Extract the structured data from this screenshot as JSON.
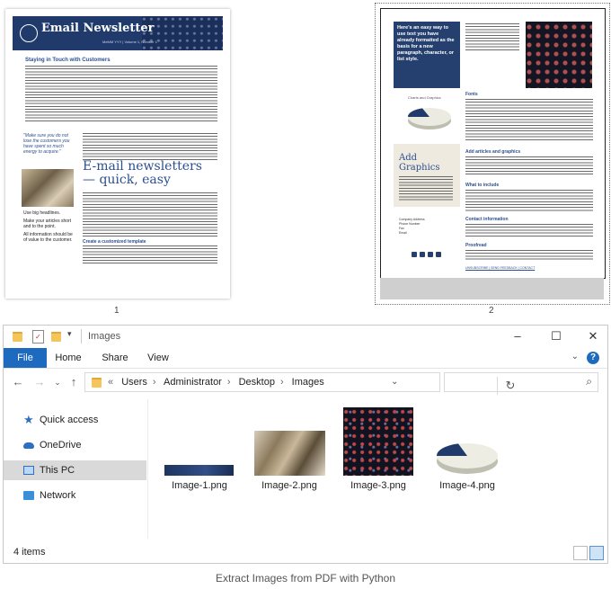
{
  "pdf_preview": {
    "page1": {
      "number": "1",
      "header_title": "Email Newsletter",
      "header_subtitle": "MeMM YYY | Volume 1, Number 1",
      "section_heading": "Staying in Touch with Customers",
      "pull_quote": "\"Make sure you do not lose the customers you have spent so much energy to acquire.\"",
      "big_heading": "E-mail newsletters — quick, easy",
      "list_items": [
        "Use big headlines.",
        "Make your articles short and to the point.",
        "All information should be of value to the customer."
      ],
      "sub_heading": "Create a customized template"
    },
    "page2": {
      "number": "2",
      "callout": "Here's an easy way to use text you have already formatted as the basis for a new paragraph, character, or list style.",
      "chart_title": "Charts and Graphics",
      "add_graphics": "Add Graphics",
      "headings": [
        "Fonts",
        "Add articles and graphics",
        "What to include",
        "Contact information",
        "Proofread"
      ],
      "contact_lines": [
        "Company Address",
        "Phone Number",
        "Fax",
        "Email"
      ],
      "footer_links": "UNSUBSCRIBE | SEND FEEDBACK | CONTACT"
    }
  },
  "explorer": {
    "title": "Images",
    "tabs": [
      "File",
      "Home",
      "Share",
      "View"
    ],
    "breadcrumb": [
      "Users",
      "Administrator",
      "Desktop",
      "Images"
    ],
    "breadcrumb_prefix": "«",
    "nav_items": [
      {
        "label": "Quick access",
        "icon": "star-icon",
        "selected": false
      },
      {
        "label": "OneDrive",
        "icon": "cloud-icon",
        "selected": false
      },
      {
        "label": "This PC",
        "icon": "computer-icon",
        "selected": true
      },
      {
        "label": "Network",
        "icon": "network-icon",
        "selected": false
      }
    ],
    "files": [
      "Image-1.png",
      "Image-2.png",
      "Image-3.png",
      "Image-4.png"
    ],
    "status": "4 items",
    "accent_color": "#1e6abf"
  },
  "caption": "Extract Images from PDF with Python"
}
